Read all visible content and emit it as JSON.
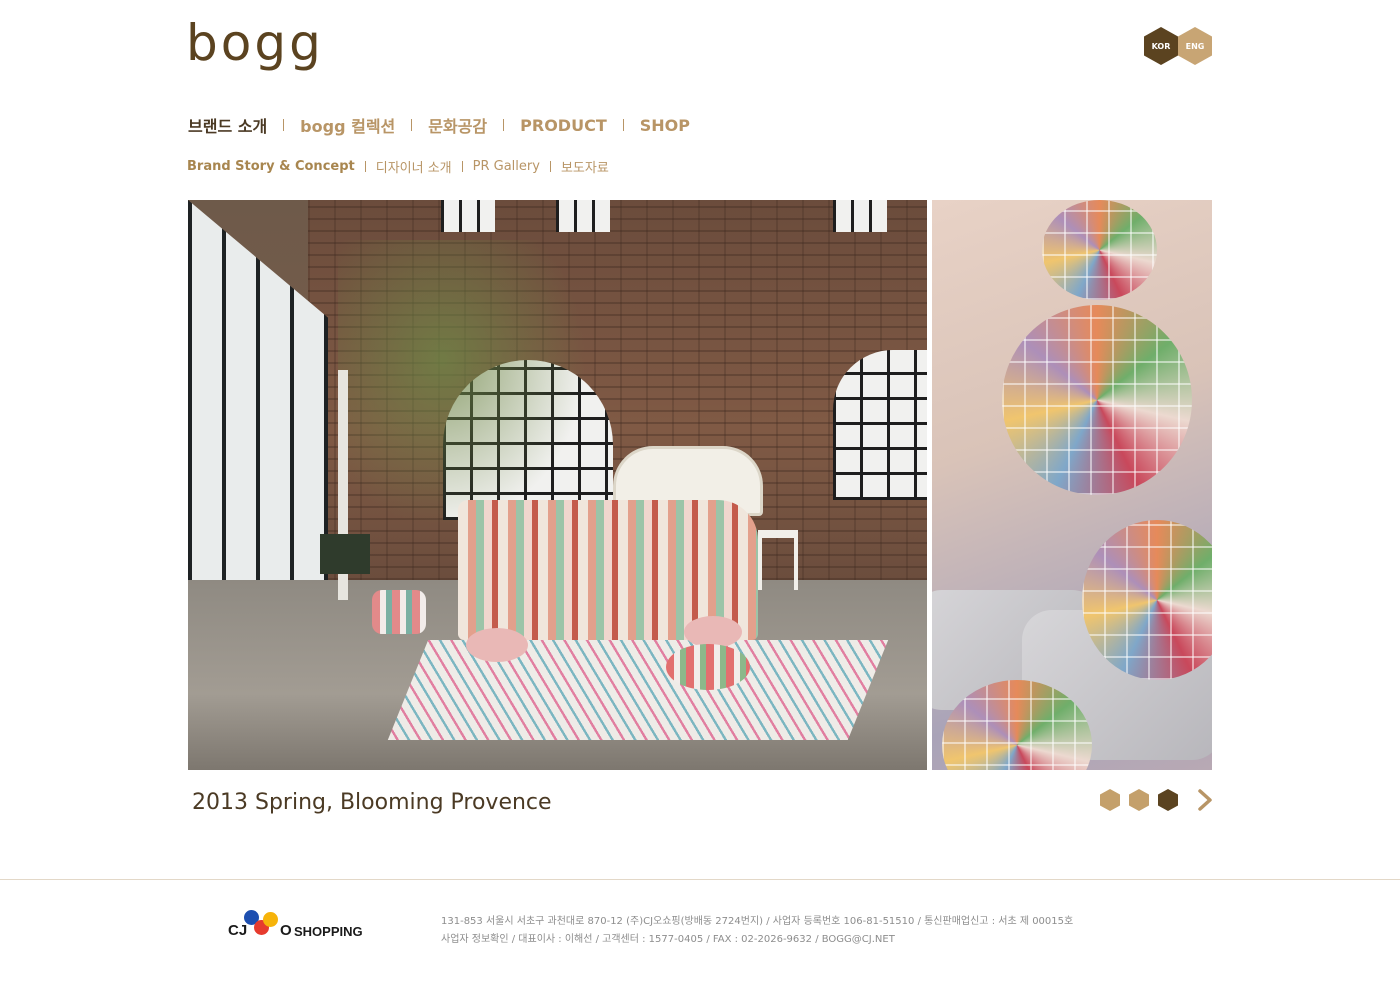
{
  "brand": {
    "logo_text": "bogg"
  },
  "language": {
    "kor": "KOR",
    "eng": "ENG"
  },
  "gnb": [
    {
      "label": "브랜드 소개"
    },
    {
      "label": "bogg 컬렉션"
    },
    {
      "label": "문화공감"
    },
    {
      "label": "PRODUCT"
    },
    {
      "label": "SHOP"
    }
  ],
  "subnav": [
    {
      "label": "Brand Story & Concept"
    },
    {
      "label": "디자이너 소개"
    },
    {
      "label": "PR Gallery"
    },
    {
      "label": "보도자료"
    }
  ],
  "slide": {
    "caption": "2013 Spring, Blooming Provence",
    "total": 3,
    "current": 3
  },
  "footer": {
    "sponsor_logo": {
      "letters": "CJ",
      "o": "O",
      "shopping": "SHOPPING"
    },
    "line1": "131-853 서울시 서초구 과천대로 870-12 (주)CJ오쇼핑(방배동 2724번지) / 사업자 등록번호 106-81-51510 / 통신판매업신고 : 서초 제 00015호",
    "line2": "사업자 정보확인 / 대표이사 : 이해선 / 고객센터 : 1577-0405  / FAX : 02-2026-9632  / BOGG@CJ.NET"
  },
  "colors": {
    "brand_dark": "#5b4320",
    "brand_light": "#c8a574",
    "nav_text": "#b89566"
  },
  "icons": {
    "next": "chevron-right-icon",
    "slide_indicator": "hexagon-dot-icon"
  }
}
